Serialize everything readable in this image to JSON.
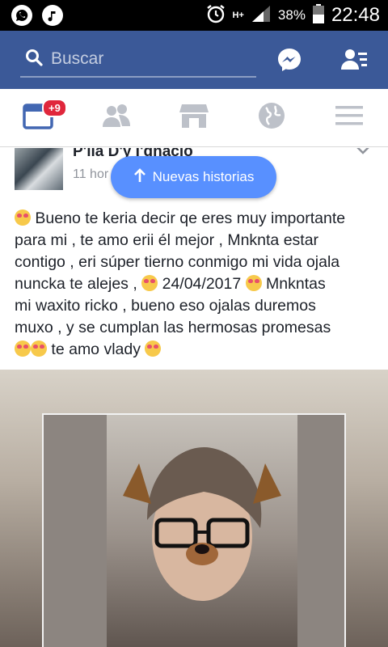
{
  "status_bar": {
    "network": "H+",
    "battery": "38%",
    "time": "22:48"
  },
  "header": {
    "search_placeholder": "Buscar"
  },
  "nav": {
    "badge": "+9"
  },
  "post": {
    "author": "P'ııa D'y I'gnació",
    "time": "11 hor",
    "lines": [
      " Bueno te keria decir qe eres muy importante",
      "para mi , te amo erii él mejor , Mnknta estar",
      "contigo  , eri súper tierno conmigo mi vida ojala",
      "nuncka te alejes , ",
      " 24/04/2017 ",
      " Mnkntas",
      "mi waxito ricko , bueno eso ojalas duremos",
      "muxo , y se cumplan las hermosas promesas",
      " te amo vlady "
    ]
  },
  "new_stories": {
    "label": "Nuevas historias"
  },
  "colors": {
    "facebook_blue": "#3b5998",
    "pill_blue": "#5890ff",
    "badge_red": "#e0273c"
  },
  "icons": [
    "whatsapp-icon",
    "music-icon",
    "alarm-icon",
    "signal-icon",
    "battery-icon",
    "search-icon",
    "messenger-icon",
    "friend-requests-icon",
    "news-feed-icon",
    "friends-icon",
    "marketplace-icon",
    "globe-icon",
    "menu-icon",
    "chevron-down-icon",
    "arrow-up-icon"
  ]
}
